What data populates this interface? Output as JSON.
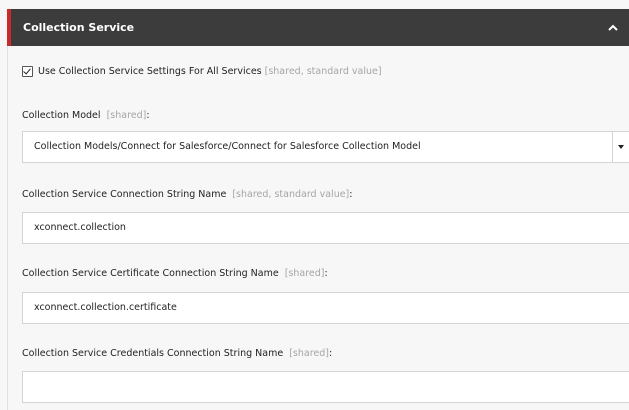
{
  "section": {
    "title": "Collection Service"
  },
  "checkbox": {
    "label": "Use Collection Service Settings For All Services",
    "meta": "[shared, standard value]",
    "checked": true
  },
  "fields": [
    {
      "label": "Collection Model",
      "meta": "[shared]",
      "suffix": ":",
      "value": "Collection Models/Connect for Salesforce/Connect for Salesforce Collection Model",
      "type": "select"
    },
    {
      "label": "Collection Service Connection String Name",
      "meta": "[shared, standard value]",
      "suffix": ":",
      "value": "xconnect.collection",
      "type": "text"
    },
    {
      "label": "Collection Service Certificate Connection String Name",
      "meta": "[shared]",
      "suffix": ":",
      "value": "xconnect.collection.certificate",
      "type": "text"
    },
    {
      "label": "Collection Service Credentials Connection String Name",
      "meta": "[shared]",
      "suffix": ":",
      "value": "",
      "type": "text"
    }
  ],
  "colors": {
    "header_bg": "#3c3c3c",
    "accent": "#c92a2a",
    "meta_text": "#a5a5a5"
  },
  "icons": {
    "collapse": "chevron-up-icon",
    "dropdown": "caret-down-icon",
    "checkbox": "check-icon"
  }
}
